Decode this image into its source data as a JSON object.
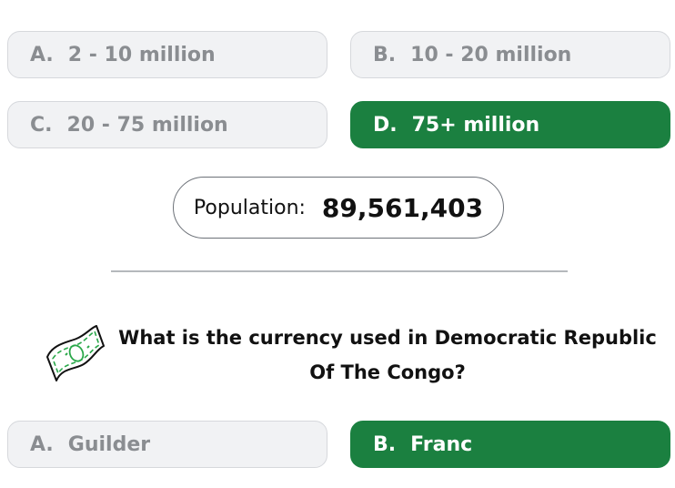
{
  "population_question": {
    "options": [
      {
        "letter": "A.",
        "text": "2 - 10 million",
        "state": "disabled"
      },
      {
        "letter": "B.",
        "text": "10 - 20 million",
        "state": "disabled"
      },
      {
        "letter": "C.",
        "text": "20 - 75 million",
        "state": "disabled"
      },
      {
        "letter": "D.",
        "text": "75+ million",
        "state": "correct"
      }
    ],
    "result": {
      "label": "Population:",
      "value": "89,561,403"
    }
  },
  "currency_question": {
    "icon": "money-bill-icon",
    "text": "What is the currency used in Democratic Republic Of The Congo?",
    "options": [
      {
        "letter": "A.",
        "text": "Guilder",
        "state": "disabled"
      },
      {
        "letter": "B.",
        "text": "Franc",
        "state": "correct"
      }
    ]
  },
  "colors": {
    "correct": "#1b8040",
    "disabled_bg": "#f1f2f4",
    "disabled_text": "#8a8d91"
  }
}
